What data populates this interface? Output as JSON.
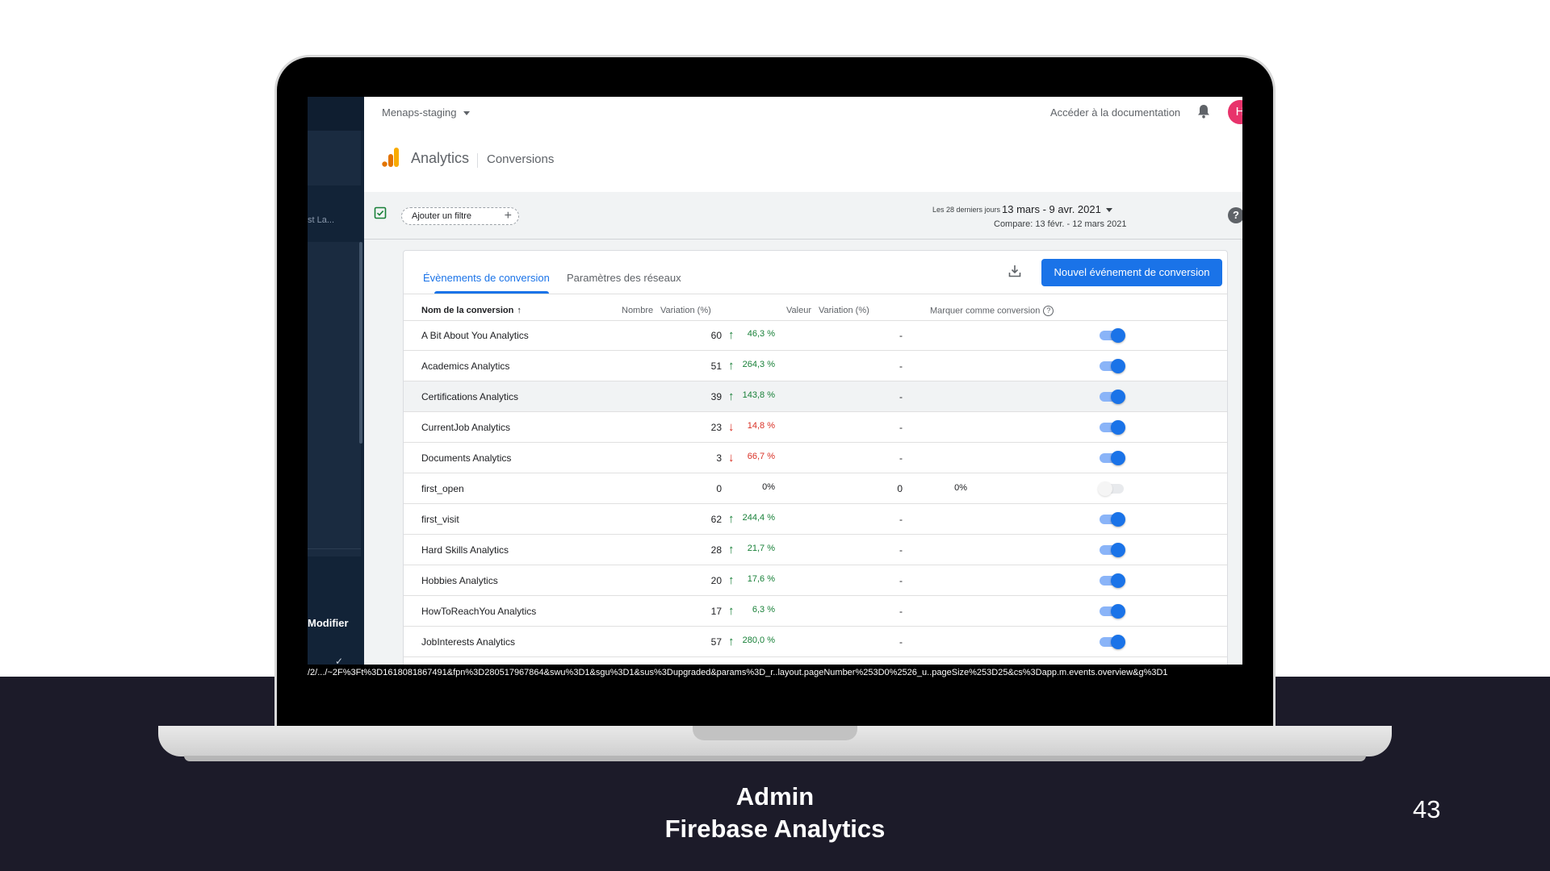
{
  "slide": {
    "caption_line1": "Admin",
    "caption_line2": "Firebase Analytics",
    "page_number": "43"
  },
  "sidebar": {
    "partial_text": "st La...",
    "modifier_label": "Modifier",
    "edit_glyph": "✓"
  },
  "topbar": {
    "project": "Menaps-staging",
    "docs_link": "Accéder à la documentation",
    "avatar_letter": "H"
  },
  "header": {
    "app_name": "Analytics",
    "page_name": "Conversions"
  },
  "filters": {
    "add_filter_label": "Ajouter un filtre",
    "plus": "+",
    "range_label": "Les 28 derniers jours",
    "range_value": "13 mars - 9 avr. 2021",
    "compare_text": "Compare: 13 févr. - 12 mars 2021",
    "help": "?"
  },
  "card": {
    "tabs": [
      {
        "label": "Évènements de conversion",
        "active": true
      },
      {
        "label": "Paramètres des réseaux",
        "active": false
      }
    ],
    "new_button": "Nouvel événement de conversion",
    "columns": {
      "name": "Nom de la conversion",
      "name_sort": "↑",
      "count": "Nombre",
      "variation": "Variation (%)",
      "value": "Valeur",
      "variation2": "Variation (%)",
      "mark": "Marquer comme conversion",
      "mark_help": "?"
    },
    "rows": [
      {
        "name": "A Bit About You Analytics",
        "count": "60",
        "trend": "up",
        "variation": "46,3 %",
        "value": "-",
        "variation2": "",
        "enabled": true,
        "highlight": false
      },
      {
        "name": "Academics Analytics",
        "count": "51",
        "trend": "up",
        "variation": "264,3 %",
        "value": "-",
        "variation2": "",
        "enabled": true,
        "highlight": false
      },
      {
        "name": "Certifications Analytics",
        "count": "39",
        "trend": "up",
        "variation": "143,8 %",
        "value": "-",
        "variation2": "",
        "enabled": true,
        "highlight": true
      },
      {
        "name": "CurrentJob Analytics",
        "count": "23",
        "trend": "down",
        "variation": "14,8 %",
        "value": "-",
        "variation2": "",
        "enabled": true,
        "highlight": false
      },
      {
        "name": "Documents Analytics",
        "count": "3",
        "trend": "down",
        "variation": "66,7 %",
        "value": "-",
        "variation2": "",
        "enabled": true,
        "highlight": false
      },
      {
        "name": "first_open",
        "count": "0",
        "trend": "none",
        "variation": "0%",
        "value": "0",
        "variation2": "0%",
        "enabled": false,
        "highlight": false
      },
      {
        "name": "first_visit",
        "count": "62",
        "trend": "up",
        "variation": "244,4 %",
        "value": "-",
        "variation2": "",
        "enabled": true,
        "highlight": false
      },
      {
        "name": "Hard Skills Analytics",
        "count": "28",
        "trend": "up",
        "variation": "21,7 %",
        "value": "-",
        "variation2": "",
        "enabled": true,
        "highlight": false
      },
      {
        "name": "Hobbies Analytics",
        "count": "20",
        "trend": "up",
        "variation": "17,6 %",
        "value": "-",
        "variation2": "",
        "enabled": true,
        "highlight": false
      },
      {
        "name": "HowToReachYou Analytics",
        "count": "17",
        "trend": "up",
        "variation": "6,3 %",
        "value": "-",
        "variation2": "",
        "enabled": true,
        "highlight": false
      },
      {
        "name": "JobInterests Analytics",
        "count": "57",
        "trend": "up",
        "variation": "280,0 %",
        "value": "-",
        "variation2": "",
        "enabled": true,
        "highlight": false
      }
    ]
  },
  "status_url": "/2/.../~2F%3Ft%3D1618081867491&fpn%3D280517967864&swu%3D1&sgu%3D1&sus%3Dupgraded&params%3D_r..layout.pageNumber%253D0%2526_u..pageSize%253D25&cs%3Dapp.m.events.overview&g%3D1",
  "colors": {
    "accent": "#1a73e8",
    "up": "#188038",
    "down": "#d93025",
    "sidebar": "#122337",
    "slide_band": "#1c1b29",
    "avatar": "#e8336b",
    "logo": "#f9ab00"
  }
}
